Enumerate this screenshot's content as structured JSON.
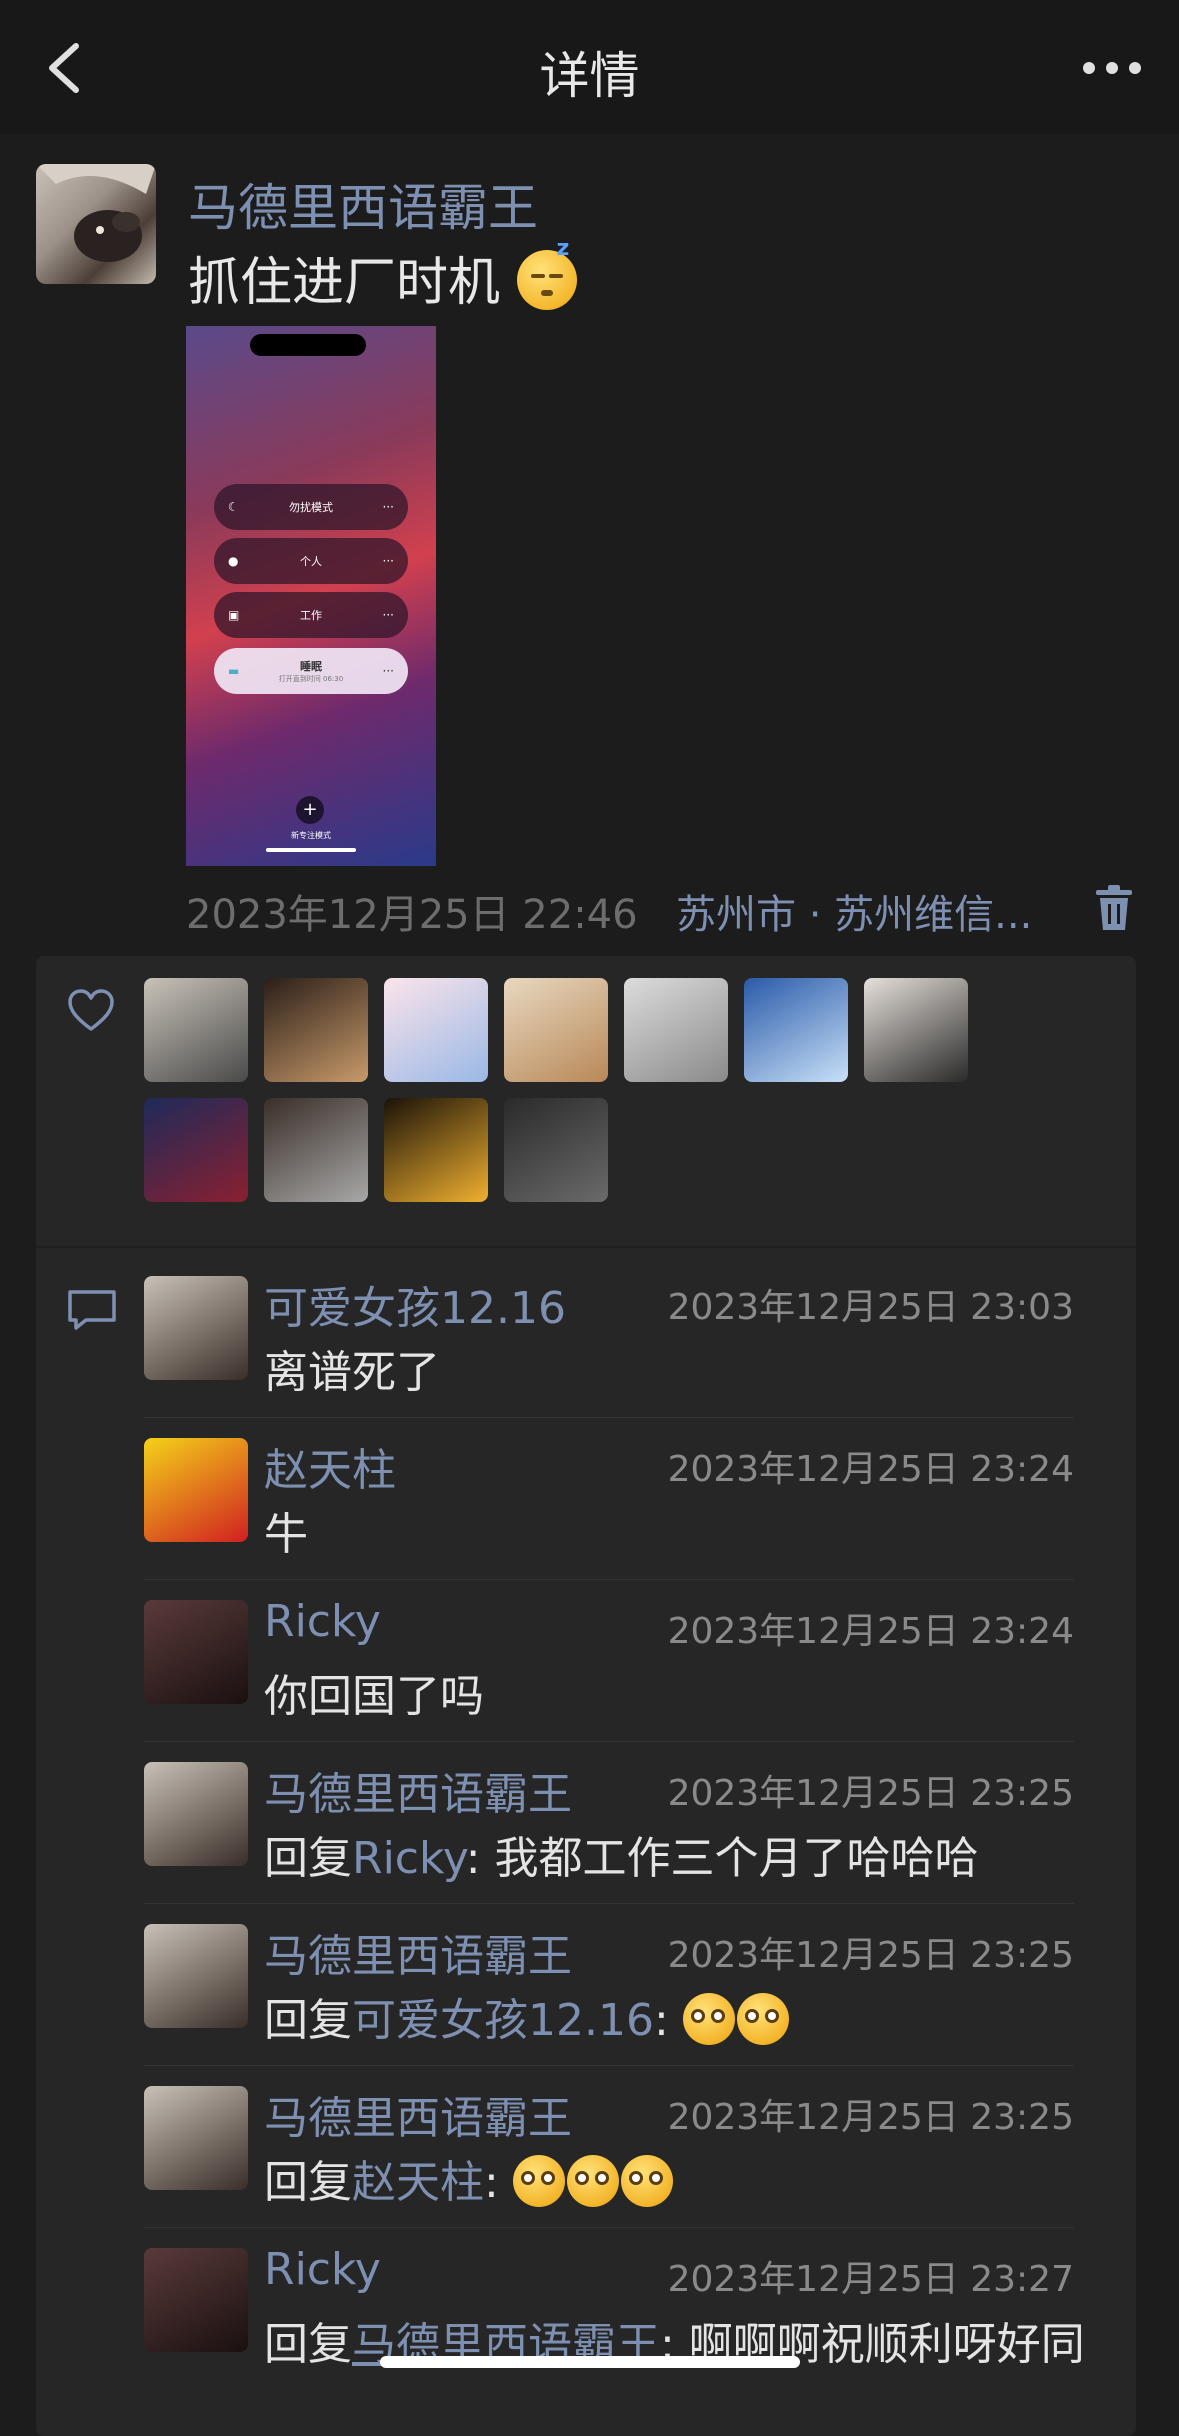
{
  "nav": {
    "title": "详情"
  },
  "post": {
    "author": "马德里西语霸王",
    "text": "抓住进厂时机",
    "timestamp": "2023年12月25日 22:46",
    "location": "苏州市 · 苏州维信...",
    "image": {
      "modes": [
        {
          "icon": "moon",
          "label": "勿扰模式"
        },
        {
          "icon": "person",
          "label": "个人"
        },
        {
          "icon": "badge",
          "label": "工作"
        },
        {
          "icon": "bed",
          "label": "睡眠",
          "sub": "打开直到时间 06:30"
        }
      ],
      "add_label": "新专注模式"
    }
  },
  "likes": {
    "avatars": [
      {
        "name": "liker-1",
        "colors": [
          "#c8c2b8",
          "#4a4a4a"
        ]
      },
      {
        "name": "liker-2",
        "colors": [
          "#2a1e18",
          "#c89a6a"
        ]
      },
      {
        "name": "liker-3",
        "colors": [
          "#fbe4ea",
          "#9ab8e6"
        ]
      },
      {
        "name": "liker-4",
        "colors": [
          "#e8d8c0",
          "#b88858"
        ]
      },
      {
        "name": "liker-5",
        "colors": [
          "#dcdcdc",
          "#8a8a8a"
        ]
      },
      {
        "name": "liker-6",
        "colors": [
          "#2a5aa8",
          "#c8e0f8"
        ]
      },
      {
        "name": "liker-7",
        "colors": [
          "#e6e0da",
          "#2a2a2a"
        ]
      },
      {
        "name": "liker-8",
        "colors": [
          "#1e2a5a",
          "#8a2030"
        ]
      },
      {
        "name": "liker-9",
        "colors": [
          "#3a2e28",
          "#a8a8a8"
        ]
      },
      {
        "name": "liker-10",
        "colors": [
          "#1a1208",
          "#f0b030"
        ]
      },
      {
        "name": "liker-11",
        "colors": [
          "#2a2a2a",
          "#6a6a6a"
        ]
      }
    ]
  },
  "comments": [
    {
      "name": "可爱女孩12.16",
      "time": "2023年12月25日 23:03",
      "text": "离谱死了",
      "avatar": [
        "#c9c1b7",
        "#3a2e28"
      ]
    },
    {
      "name": "赵天柱",
      "time": "2023年12月25日 23:24",
      "text": "牛",
      "avatar": [
        "#f4d21a",
        "#d02020"
      ]
    },
    {
      "name": "Ricky",
      "time": "2023年12月25日 23:24",
      "text": "你回国了吗",
      "avatar": [
        "#5a3a3a",
        "#1a1010"
      ]
    },
    {
      "name": "马德里西语霸王",
      "time": "2023年12月25日 23:25",
      "prefix": "回复",
      "reply_to": "Ricky",
      "text": ": 我都工作三个月了哈哈哈",
      "avatar": [
        "#c9c1b7",
        "#3a2e28"
      ]
    },
    {
      "name": "马德里西语霸王",
      "time": "2023年12月25日 23:25",
      "prefix": "回复",
      "reply_to": "可爱女孩12.16",
      "text": ": ",
      "emojis": 2,
      "avatar": [
        "#c9c1b7",
        "#3a2e28"
      ]
    },
    {
      "name": "马德里西语霸王",
      "time": "2023年12月25日 23:25",
      "prefix": "回复",
      "reply_to": "赵天柱",
      "text": ": ",
      "emojis": 3,
      "avatar": [
        "#c9c1b7",
        "#3a2e28"
      ]
    },
    {
      "name": "Ricky",
      "time": "2023年12月25日 23:27",
      "prefix": "回复",
      "reply_to": "马德里西语霸王",
      "text": ": 啊啊啊祝顺利呀好同",
      "avatar": [
        "#5a3a3a",
        "#1a1010"
      ]
    }
  ],
  "colors": {
    "background": "#1c1c1c",
    "panel": "#262626",
    "link": "#7e90b2"
  }
}
